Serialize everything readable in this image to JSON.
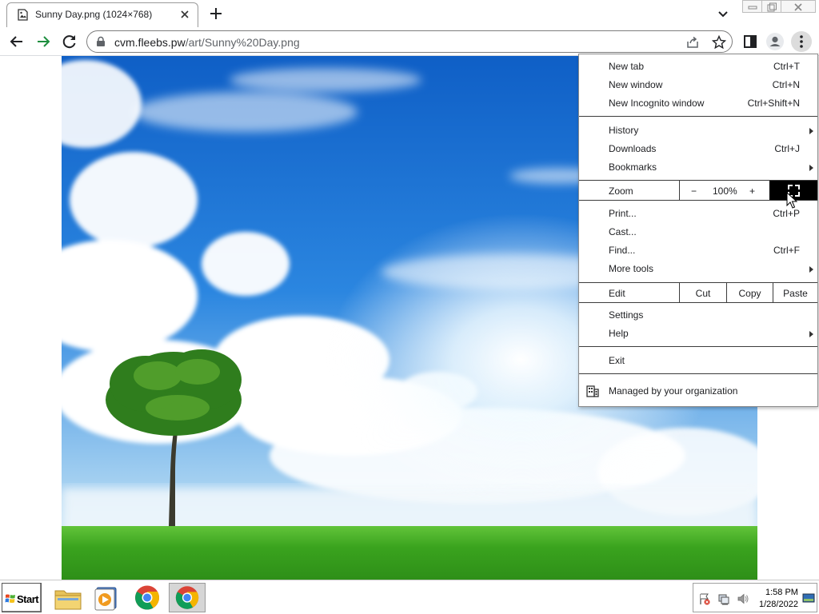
{
  "browser": {
    "tab": {
      "title": "Sunny Day.png (1024×768)"
    },
    "address_bar": {
      "host": "cvm.fleebs.pw",
      "path": "/art/Sunny%20Day.png"
    }
  },
  "page": {
    "image_name": "Sunny Day.png"
  },
  "menu": {
    "items": [
      {
        "label": "New tab",
        "shortcut": "Ctrl+T"
      },
      {
        "label": "New window",
        "shortcut": "Ctrl+N"
      },
      {
        "label": "New Incognito window",
        "shortcut": "Ctrl+Shift+N"
      },
      {
        "label": "History",
        "submenu": true
      },
      {
        "label": "Downloads",
        "shortcut": "Ctrl+J"
      },
      {
        "label": "Bookmarks",
        "submenu": true
      },
      {
        "label": "Print...",
        "shortcut": "Ctrl+P"
      },
      {
        "label": "Cast..."
      },
      {
        "label": "Find...",
        "shortcut": "Ctrl+F"
      },
      {
        "label": "More tools",
        "submenu": true
      },
      {
        "label": "Settings"
      },
      {
        "label": "Help",
        "submenu": true
      },
      {
        "label": "Exit"
      },
      {
        "label": "Managed by your organization"
      }
    ],
    "zoom": {
      "label": "Zoom",
      "minus": "−",
      "value": "100%",
      "plus": "+"
    },
    "edit": {
      "label": "Edit",
      "cut": "Cut",
      "copy": "Copy",
      "paste": "Paste"
    }
  },
  "taskbar": {
    "start_label": "Start",
    "apps": [
      "file-explorer-icon",
      "media-player-icon",
      "chrome-icon",
      "chrome-icon"
    ],
    "clock": {
      "time": "1:58 PM",
      "date": "1/28/2022"
    }
  },
  "colors": {
    "sky": "#1f6fd1",
    "grass": "#3aa31e",
    "chrome_green": "#1e8e3e"
  }
}
